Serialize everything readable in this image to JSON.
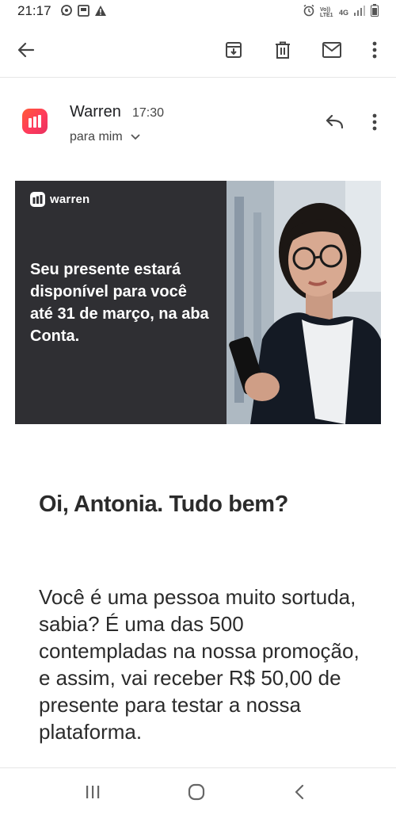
{
  "status_bar": {
    "time": "21:17",
    "left_icons": [
      "whatsapp-icon",
      "screenshot-icon",
      "warning-icon"
    ],
    "right_icons": [
      "alarm-icon",
      "volte-icon",
      "4g-icon",
      "signal-icon",
      "battery-icon"
    ],
    "volte_label": "Vo)) LTE1",
    "network_label": "4G"
  },
  "toolbar": {
    "icons": [
      "back-arrow-icon",
      "archive-icon",
      "delete-icon",
      "mail-icon",
      "more-vert-icon"
    ]
  },
  "email": {
    "sender_name": "Warren",
    "time": "17:30",
    "recipient": "para mim",
    "accent_color": "#ff4a3d"
  },
  "banner": {
    "logo_text": "warren",
    "headline": "Seu presente estará disponível para você até 31 de março, na aba Conta.",
    "background_color": "#2f2f33"
  },
  "content": {
    "greeting": "Oi, Antonia. Tudo bem?",
    "paragraph": "Você é uma pessoa muito sortuda, sabia? É uma das 500 contempladas na nossa promoção, e assim, vai receber R$ 50,00 de presente para testar a nossa plataforma."
  },
  "nav_bar": {
    "icons": [
      "recents-icon",
      "home-icon",
      "back-icon"
    ]
  }
}
